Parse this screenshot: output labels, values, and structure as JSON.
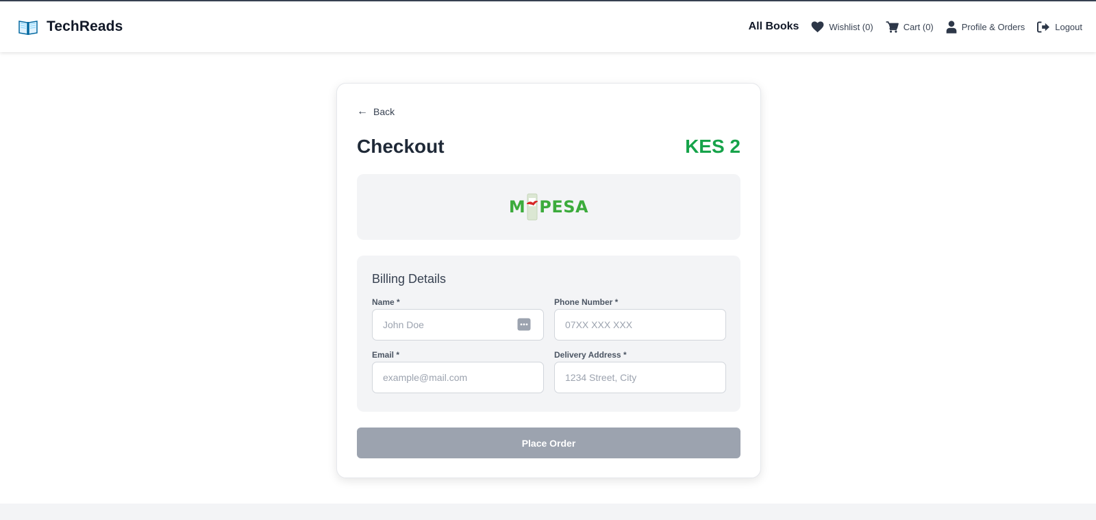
{
  "app": {
    "brand_name": "TechReads",
    "brand_icon": "open-book-icon"
  },
  "nav": {
    "all_books": "All Books",
    "wishlist": "Wishlist (0)",
    "cart": "Cart (0)",
    "profile": "Profile & Orders",
    "logout": "Logout"
  },
  "checkout": {
    "back_label": "Back",
    "title": "Checkout",
    "total": "KES 2",
    "payment_logo_text": "M-PESA",
    "billing": {
      "title": "Billing Details",
      "name_label": "Name *",
      "name_placeholder": "John Doe",
      "name_value": "",
      "phone_label": "Phone Number *",
      "phone_placeholder": "07XX XXX XXX",
      "phone_value": "",
      "email_label": "Email *",
      "email_placeholder": "example@mail.com",
      "email_value": "",
      "address_label": "Delivery Address *",
      "address_placeholder": "1234 Street, City",
      "address_value": ""
    },
    "place_order_label": "Place Order"
  },
  "colors": {
    "accent_total": "#16a34a",
    "mpesa_green": "#3cab3c",
    "button_disabled": "#9ca3af",
    "panel_bg": "#f3f4f6"
  }
}
